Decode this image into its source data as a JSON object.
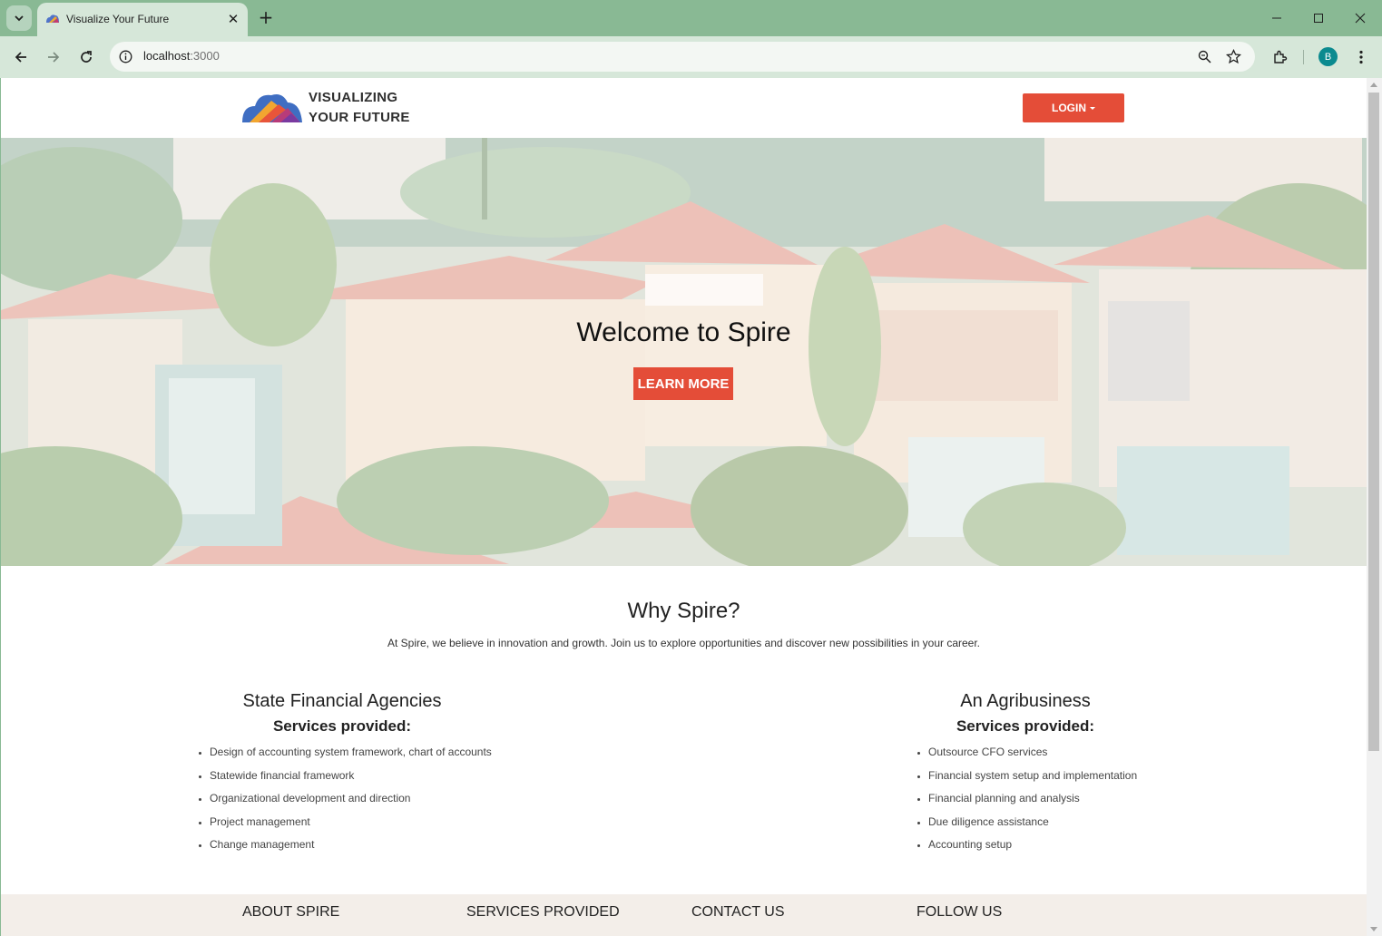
{
  "browser": {
    "tab_title": "Visualize Your Future",
    "url_host": "localhost",
    "url_port": ":3000",
    "profile_initial": "B"
  },
  "header": {
    "brand_line1": "VISUALIZING",
    "brand_line2": "YOUR FUTURE",
    "login_label": "LOGIN"
  },
  "hero": {
    "title": "Welcome to Spire",
    "button_label": "LEARN MORE"
  },
  "why": {
    "title": "Why Spire?",
    "text": "At Spire, we believe in innovation and growth. Join us to explore opportunities and discover new possibilities in your career."
  },
  "columns": [
    {
      "title": "State Financial Agencies",
      "subtitle": "Services provided:",
      "items": [
        "Design of accounting system framework, chart of accounts",
        "Statewide financial framework",
        "Organizational development and direction",
        "Project management",
        "Change management"
      ]
    },
    {
      "title": "An Agribusiness",
      "subtitle": "Services provided:",
      "items": [
        "Outsource CFO services",
        "Financial system setup and implementation",
        "Financial planning and analysis",
        "Due diligence assistance",
        "Accounting setup"
      ]
    }
  ],
  "footer": {
    "about": "ABOUT SPIRE",
    "services": "SERVICES PROVIDED",
    "contact": "CONTACT US",
    "follow": "FOLLOW US"
  },
  "colors": {
    "accent": "#e44d38",
    "chrome": "#89b994",
    "toolbar": "#d6e7d9"
  }
}
